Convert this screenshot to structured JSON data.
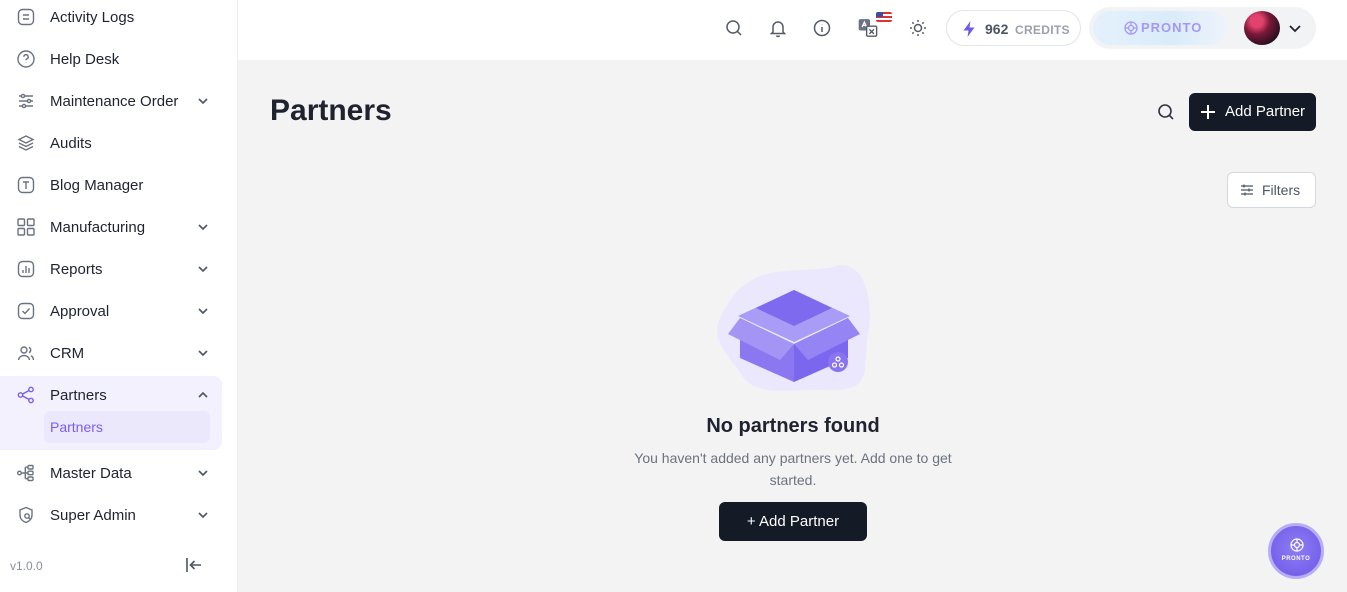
{
  "sidebar": {
    "items": [
      {
        "label": "Activity Logs",
        "icon": "list-doc-icon"
      },
      {
        "label": "Help Desk",
        "icon": "question-circle-icon"
      },
      {
        "label": "Maintenance Order",
        "icon": "sliders-icon"
      },
      {
        "label": "Audits",
        "icon": "layers-icon"
      },
      {
        "label": "Blog Manager",
        "icon": "text-square-icon"
      },
      {
        "label": "Manufacturing",
        "icon": "grid-shapes-icon"
      },
      {
        "label": "Reports",
        "icon": "bar-chart-icon"
      },
      {
        "label": "Approval",
        "icon": "check-square-icon"
      },
      {
        "label": "CRM",
        "icon": "users-icon"
      },
      {
        "label": "Partners",
        "icon": "share-nodes-icon"
      },
      {
        "label": "Master Data",
        "icon": "hierarchy-icon"
      },
      {
        "label": "Super Admin",
        "icon": "shield-search-icon"
      }
    ],
    "active_sub_item": "Partners",
    "version": "v1.0.0"
  },
  "topbar": {
    "icons": [
      "search-icon",
      "bell-icon",
      "info-icon",
      "translate-icon",
      "sun-icon"
    ],
    "credits_value": "962",
    "credits_label": "CREDITS",
    "brand": "PRONTO"
  },
  "main": {
    "title": "Partners",
    "add_button_label": "Add Partner",
    "filters_label": "Filters",
    "empty_title": "No partners found",
    "empty_description": "You haven't added any partners yet. Add one to get started.",
    "empty_button_label": "+ Add Partner"
  },
  "fab": {
    "label": "PRONTO"
  },
  "colors": {
    "accent": "#7c5cf0",
    "dark_button": "#151a27",
    "background": "#f3f3f3"
  }
}
